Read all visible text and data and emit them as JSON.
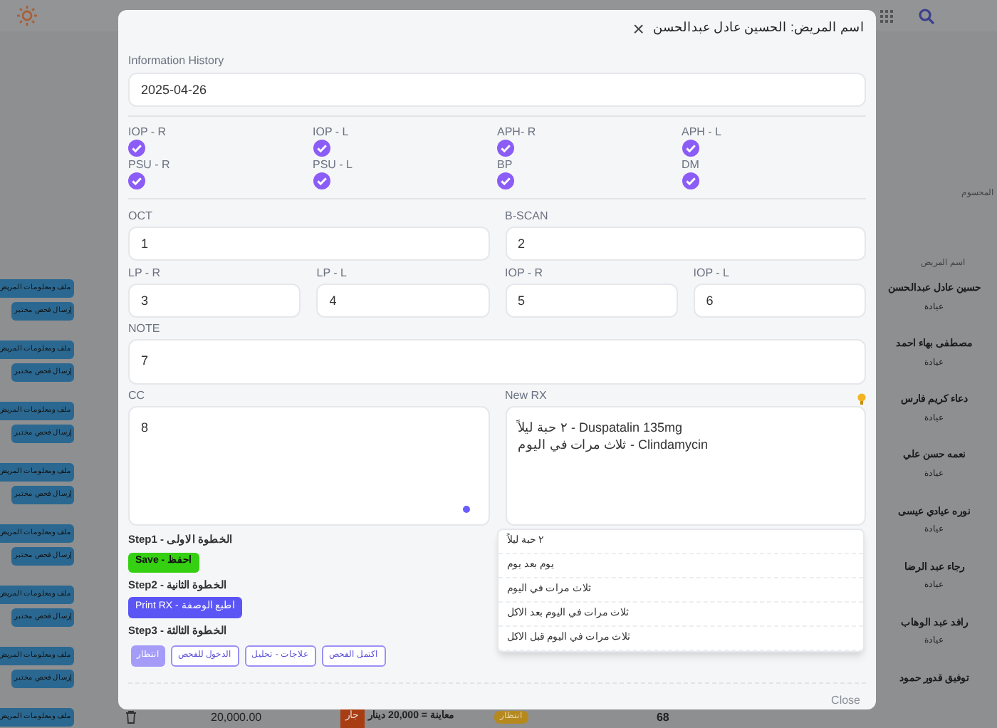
{
  "background": {
    "action_groups": [
      [
        "ملف ومعلومات المريض",
        "إرسال فحص مختبر"
      ],
      [
        "ملف ومعلومات المريض",
        "إرسال فحص مختبر"
      ],
      [
        "ملف ومعلومات المريض",
        "إرسال فحص مختبر"
      ],
      [
        "ملف ومعلومات المريض",
        "إرسال فحص مختبر"
      ],
      [
        "ملف ومعلومات المريض",
        "إرسال فحص مختبر"
      ],
      [
        "ملف ومعلومات المريض",
        "إرسال فحص مختبر"
      ],
      [
        "ملف ومعلومات المريض",
        "إرسال فحص مختبر"
      ],
      [
        "ملف ومعلومات المريض"
      ]
    ],
    "column_cut": "المحسوم",
    "patient_header": "اسم المريض",
    "patients": [
      {
        "name": "حسين عادل عبدالحسن",
        "type": "عيادة"
      },
      {
        "name": "مصطفى بهاء احمد",
        "type": "عيادة"
      },
      {
        "name": "دعاء كريم فارس",
        "type": "عيادة"
      },
      {
        "name": "نعمه حسن علي",
        "type": "عيادة"
      },
      {
        "name": "نوره عيادي عيسى",
        "type": "عيادة"
      },
      {
        "name": "رجاء عبد الرضا",
        "type": "عيادة"
      },
      {
        "name": "رافد عبد الوهاب",
        "type": "عيادة"
      },
      {
        "name": "توفيق قدور حمود"
      }
    ],
    "bottom_row": {
      "amount": "20,000.00",
      "badge": "جار",
      "description": "معاينة = 20,000 دينار",
      "queue": "انتظار",
      "number": "68"
    }
  },
  "modal": {
    "title": "اسم المريض: الحسين عادل عبدالحسن",
    "close_symbol": "×",
    "history": {
      "label": "Information History",
      "value": "2025-04-26"
    },
    "checks": [
      {
        "label": "APH - L",
        "checked": true
      },
      {
        "label": "APH- R",
        "checked": true
      },
      {
        "label": "IOP - L",
        "checked": true
      },
      {
        "label": "IOP - R",
        "checked": true
      },
      {
        "label": "DM",
        "checked": true
      },
      {
        "label": "BP",
        "checked": true
      },
      {
        "label": "PSU - L",
        "checked": true
      },
      {
        "label": "PSU - R",
        "checked": true
      }
    ],
    "wide_fields": [
      {
        "label": "B-SCAN",
        "value": "2"
      },
      {
        "label": "OCT",
        "value": "1"
      }
    ],
    "small_fields": [
      {
        "label": "IOP - L",
        "value": "6"
      },
      {
        "label": "IOP - R",
        "value": "5"
      },
      {
        "label": "LP - L",
        "value": "4"
      },
      {
        "label": "LP - R",
        "value": "3"
      }
    ],
    "note": {
      "label": "NOTE",
      "value": "7"
    },
    "cc": {
      "label": "CC",
      "value": "8"
    },
    "rx": {
      "label": "New RX",
      "lines": [
        "٢ حبة ليلاً - Duspatalin 135mg",
        "ثلاث مرات في اليوم - Clindamycin"
      ]
    },
    "suggestions": [
      "٢ حبة ليلاً",
      "يوم بعد يوم",
      "ثلاث مرات في اليوم",
      "ثلاث مرات في اليوم بعد الاكل",
      "ثلاث مرات في اليوم قبل الاكل"
    ],
    "steps": [
      {
        "label": "Step1 - الخطوة الاولى",
        "buttons": [
          {
            "kind": "save",
            "label": "Save - احفظ"
          }
        ]
      },
      {
        "label": "Step2 - الخطوة الثانية",
        "buttons": [
          {
            "kind": "print",
            "label": "Print RX - اطبع الوصفة"
          }
        ]
      },
      {
        "label": "Step3 - الخطوة الثالثة",
        "buttons": [
          {
            "kind": "status",
            "label": "اكتمل الفحص",
            "selected": false
          },
          {
            "kind": "status",
            "label": "علاجات - تحليل",
            "selected": false
          },
          {
            "kind": "status",
            "label": "الدخول للفحص",
            "selected": false
          },
          {
            "kind": "status",
            "label": "انتظار",
            "selected": true
          }
        ]
      }
    ],
    "footer_button": "Close"
  }
}
